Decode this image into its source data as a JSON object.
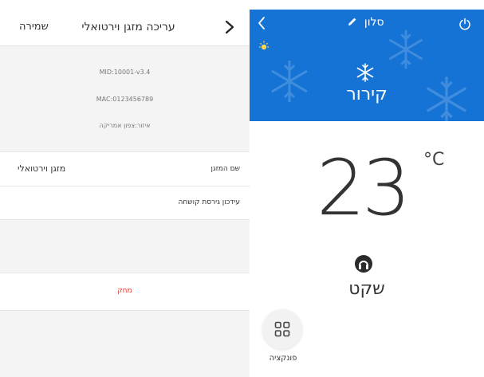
{
  "edit_screen": {
    "save_label": "שמירה",
    "title": "עריכה  מזגן וירטואלי",
    "mid": "MID:10001-v3.4",
    "mac": "MAC:0123456789",
    "region": "איזור:צפון אמריקה",
    "name_label": "שם המזגן",
    "name_value": "מזגן וירטואלי",
    "firmware_label": "עידכון גירסת קושחה",
    "delete_label": "מחק"
  },
  "control_screen": {
    "room_name": "סלון",
    "mode_label": "קירור",
    "temperature": "23",
    "unit": "°C",
    "fan_label": "שקט",
    "function_label": "פונקציה",
    "accent_color": "#1673d6",
    "delete_color": "#e53935"
  }
}
